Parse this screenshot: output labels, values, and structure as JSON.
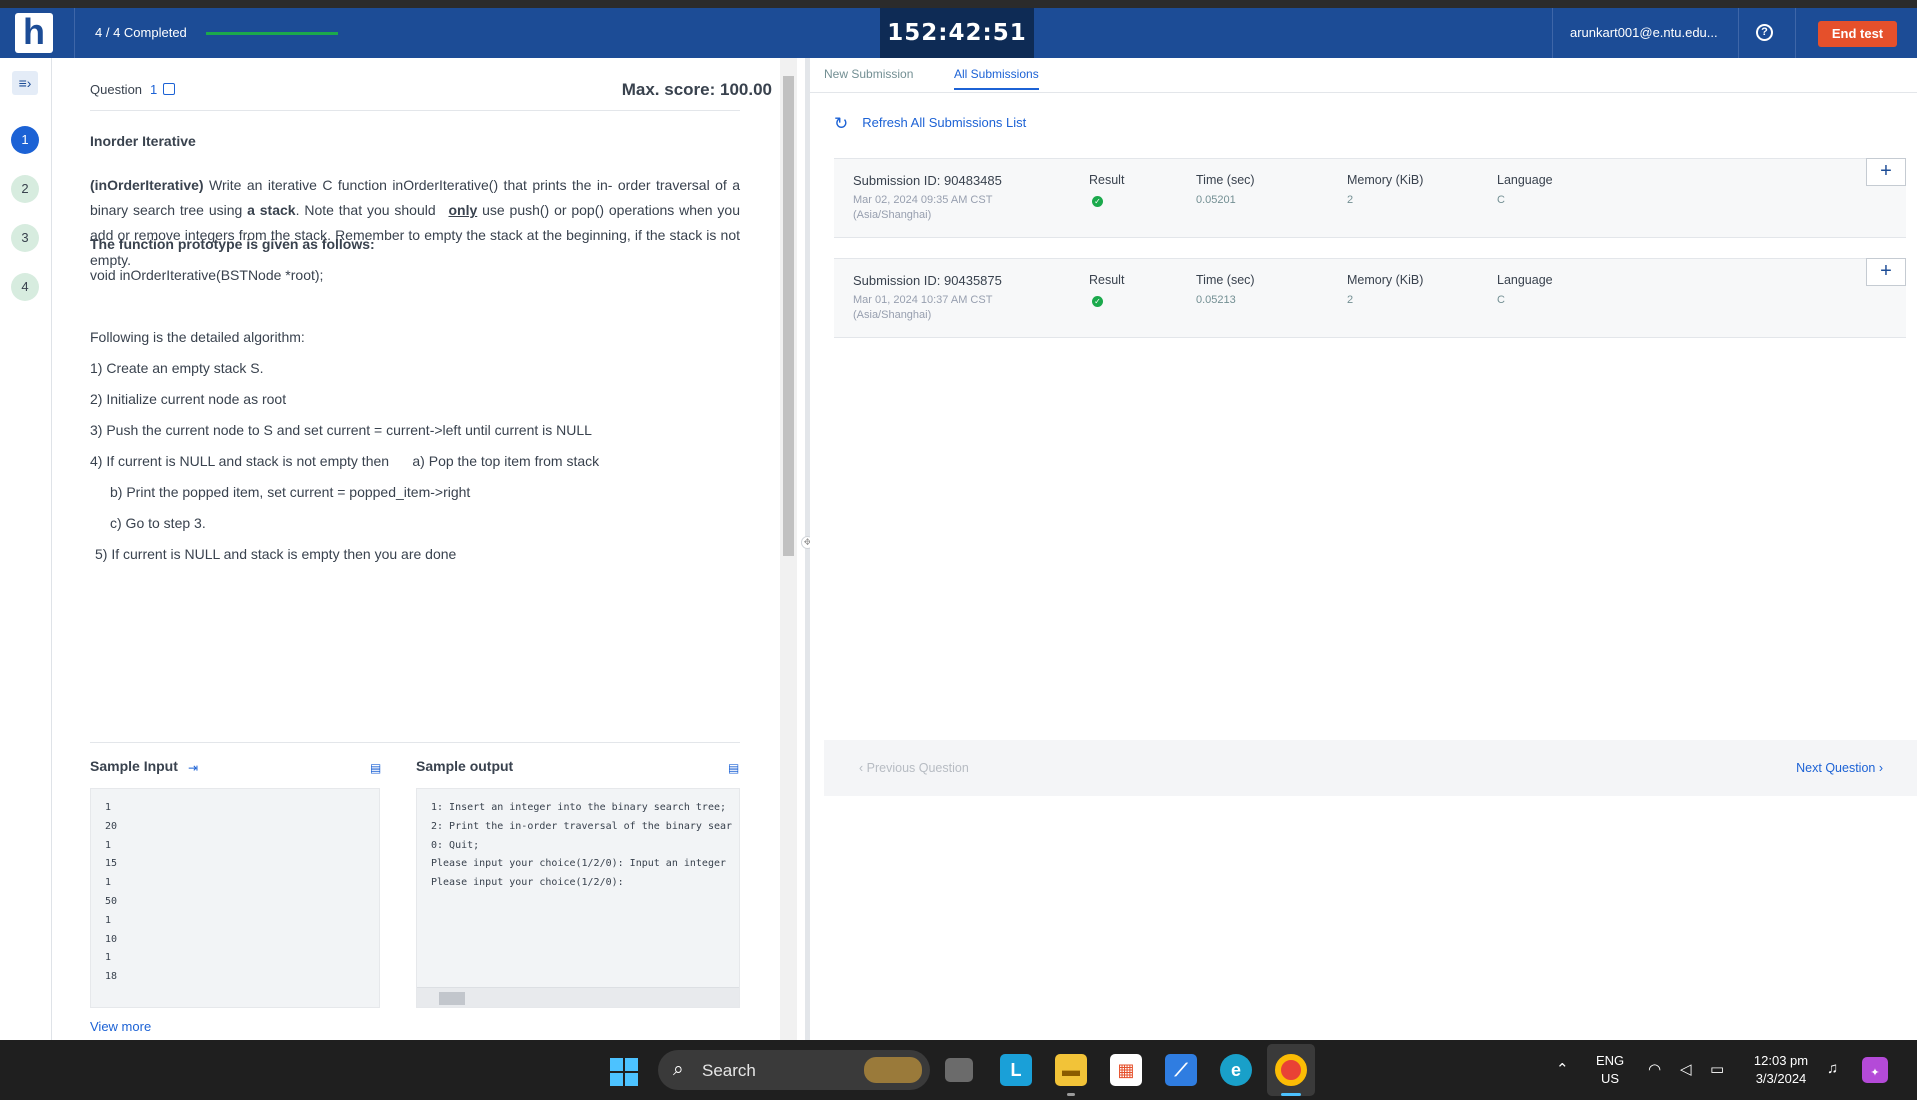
{
  "header": {
    "logo": "h",
    "progress_label": "4 / 4 Completed",
    "progress_fraction": 1.0,
    "timer": "152:42:51",
    "email": "arunkart001@e.ntu.edu...",
    "help": "?",
    "end_test": "End test"
  },
  "sidebar": {
    "menu_glyph": "≡›",
    "questions": [
      "1",
      "2",
      "3",
      "4"
    ],
    "active": "1"
  },
  "question": {
    "label": "Question",
    "number": "1",
    "max_score": "Max. score: 100.00",
    "title": "Inorder Iterative",
    "desc": {
      "bold_name": "(inOrderIterative)",
      "text1": " Write an iterative C function inOrderIterative() that prints the in- order traversal of a binary search tree using ",
      "bold_stack": "a stack",
      "text2": ". Note that you should ",
      "only": "only",
      "text3": " use push() or pop() operations when you add or remove integers from the stack. Remember to empty the stack at the beginning, if the stack is not empty."
    },
    "prototype_heading": "The function prototype is given as follows:",
    "prototype": "void inOrderIterative(BSTNode *root);",
    "algo_intro": "Following is the detailed algorithm:",
    "steps": {
      "s1": "1) Create an empty stack S.",
      "s2": "2) Initialize current node as root",
      "s3": "3) Push the current node to S and set current = current->left until current is NULL",
      "s4": "4) If current is NULL and stack is not empty then      a) Pop the top item from stack",
      "s4b": "b) Print the popped item, set current = popped_item->right",
      "s4c": "c) Go to step 3.",
      "s5": "5) If current is NULL and stack is empty then you are done"
    },
    "sample_input_label": "Sample Input",
    "sample_output_label": "Sample output",
    "sample_input": "1\n20\n1\n15\n1\n50\n1\n10\n1\n18",
    "sample_output": "1: Insert an integer into the binary search tree;\n2: Print the in-order traversal of the binary sear\n0: Quit;\nPlease input your choice(1/2/0): Input an integer\nPlease input your choice(1/2/0):",
    "view_more": "View more"
  },
  "submissions": {
    "tabs": [
      "New Submission",
      "All Submissions"
    ],
    "active_tab": "All Submissions",
    "refresh_label": "Refresh All Submissions List",
    "columns": {
      "result": "Result",
      "time": "Time (sec)",
      "memory": "Memory (KiB)",
      "language": "Language"
    },
    "rows": [
      {
        "id": "Submission ID: 90483485",
        "date": "Mar 02, 2024 09:35 AM CST",
        "tz": "(Asia/Shanghai)",
        "time": "0.05201",
        "memory": "2",
        "language": "C"
      },
      {
        "id": "Submission ID: 90435875",
        "date": "Mar 01, 2024 10:37 AM CST",
        "tz": "(Asia/Shanghai)",
        "time": "0.05213",
        "memory": "2",
        "language": "C"
      }
    ],
    "prev_question": "‹ Previous Question",
    "next_question": "Next Question ›"
  },
  "taskbar": {
    "search_placeholder": "Search",
    "lang_line1": "ENG",
    "lang_line2": "US",
    "time": "12:03 pm",
    "date": "3/3/2024"
  },
  "colors": {
    "header_bg": "#1c4c96",
    "timer_bg": "#0e2b55",
    "end_test": "#e5502b",
    "accent_blue": "#1c62d5",
    "success": "#1ba94c"
  }
}
